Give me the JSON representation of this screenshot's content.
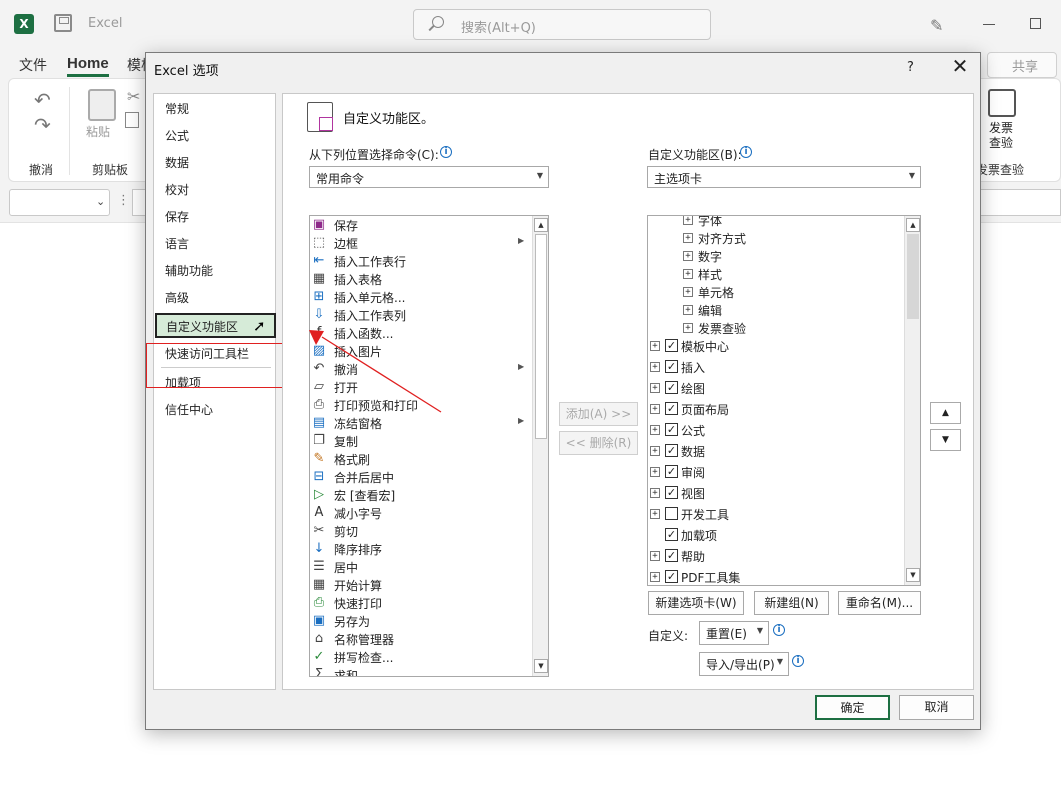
{
  "app": {
    "name": "Excel",
    "search_placeholder": "搜索(Alt+Q)",
    "app_icon_letter": "X"
  },
  "ribbon_tabs": {
    "file": "文件",
    "home": "Home",
    "template": "模板",
    "share": "共享"
  },
  "ribbon": {
    "undo_group": "撤消",
    "paste": "粘贴",
    "clipboard_group": "剪贴板",
    "invoice_label": "发票查验",
    "invoice_group": "发票查验"
  },
  "dialog": {
    "title": "Excel 选项",
    "help": "?",
    "close": "✕",
    "categories": [
      "常规",
      "公式",
      "数据",
      "校对",
      "保存",
      "语言",
      "辅助功能",
      "高级",
      "自定义功能区",
      "快速访问工具栏",
      "加载项",
      "信任中心"
    ],
    "selected_category": "自定义功能区",
    "section_title": "自定义功能区。",
    "left_label": "从下列位置选择命令(C):",
    "right_label": "自定义功能区(B):",
    "command_source": "常用命令",
    "tab_source": "主选项卡",
    "commands": [
      {
        "icon": "save-icon",
        "label": "保存",
        "glyph": "▣",
        "color": "#8e2a8a"
      },
      {
        "icon": "border-icon",
        "label": "边框",
        "glyph": "⬚",
        "color": "#555",
        "submenu": true
      },
      {
        "icon": "insert-row-icon",
        "label": "插入工作表行",
        "glyph": "⇤",
        "color": "#1a6ec0"
      },
      {
        "icon": "insert-table-icon",
        "label": "插入表格",
        "glyph": "▦",
        "color": "#444"
      },
      {
        "icon": "insert-cell-icon",
        "label": "插入单元格...",
        "glyph": "⊞",
        "color": "#1a6ec0"
      },
      {
        "icon": "insert-column-icon",
        "label": "插入工作表列",
        "glyph": "⇩",
        "color": "#1a6ec0"
      },
      {
        "icon": "function-icon",
        "label": "插入函数...",
        "glyph": "ƒ",
        "color": "#333"
      },
      {
        "icon": "picture-icon",
        "label": "插入图片",
        "glyph": "▨",
        "color": "#1a6ec0"
      },
      {
        "icon": "undo-icon",
        "label": "撤消",
        "glyph": "↶",
        "color": "#444",
        "submenu": true
      },
      {
        "icon": "open-icon",
        "label": "打开",
        "glyph": "▱",
        "color": "#444"
      },
      {
        "icon": "print-preview-icon",
        "label": "打印预览和打印",
        "glyph": "⎙",
        "color": "#444"
      },
      {
        "icon": "freeze-panes-icon",
        "label": "冻结窗格",
        "glyph": "▤",
        "color": "#1a6ec0",
        "submenu": true
      },
      {
        "icon": "copy-icon",
        "label": "复制",
        "glyph": "❐",
        "color": "#444"
      },
      {
        "icon": "format-painter-icon",
        "label": "格式刷",
        "glyph": "✎",
        "color": "#c0701a"
      },
      {
        "icon": "merge-center-icon",
        "label": "合并后居中",
        "glyph": "⊟",
        "color": "#1a6ec0"
      },
      {
        "icon": "macro-icon",
        "label": "宏 [查看宏]",
        "glyph": "▷",
        "color": "#2a8a3a"
      },
      {
        "icon": "decrease-font-icon",
        "label": "减小字号",
        "glyph": "A",
        "color": "#333"
      },
      {
        "icon": "cut-icon",
        "label": "剪切",
        "glyph": "✂",
        "color": "#444"
      },
      {
        "icon": "sort-desc-icon",
        "label": "降序排序",
        "glyph": "↓",
        "color": "#1a6ec0"
      },
      {
        "icon": "center-icon",
        "label": "居中",
        "glyph": "☰",
        "color": "#444"
      },
      {
        "icon": "calculate-icon",
        "label": "开始计算",
        "glyph": "▦",
        "color": "#444"
      },
      {
        "icon": "quick-print-icon",
        "label": "快速打印",
        "glyph": "⎙",
        "color": "#2a8a3a"
      },
      {
        "icon": "save-as-icon",
        "label": "另存为",
        "glyph": "▣",
        "color": "#1a6ec0"
      },
      {
        "icon": "name-manager-icon",
        "label": "名称管理器",
        "glyph": "⌂",
        "color": "#444"
      },
      {
        "icon": "spell-check-icon",
        "label": "拼写检查...",
        "glyph": "✓",
        "color": "#2a8a3a"
      },
      {
        "icon": "sum-icon",
        "label": "求和",
        "glyph": "Σ",
        "color": "#444"
      }
    ],
    "add_button": "添加(A) >>",
    "remove_button": "<< 删除(R)",
    "tree_items": [
      {
        "level": 1,
        "label": "字体",
        "checkbox": false,
        "expander": true
      },
      {
        "level": 1,
        "label": "对齐方式",
        "checkbox": false,
        "expander": true
      },
      {
        "level": 1,
        "label": "数字",
        "checkbox": false,
        "expander": true
      },
      {
        "level": 1,
        "label": "样式",
        "checkbox": false,
        "expander": true
      },
      {
        "level": 1,
        "label": "单元格",
        "checkbox": false,
        "expander": true
      },
      {
        "level": 1,
        "label": "编辑",
        "checkbox": false,
        "expander": true
      },
      {
        "level": 1,
        "label": "发票查验",
        "checkbox": false,
        "expander": true
      },
      {
        "level": 0,
        "label": "模板中心",
        "checkbox": true,
        "checked": true,
        "expander": true
      },
      {
        "level": 0,
        "label": "插入",
        "checkbox": true,
        "checked": true,
        "expander": true
      },
      {
        "level": 0,
        "label": "绘图",
        "checkbox": true,
        "checked": true,
        "expander": true
      },
      {
        "level": 0,
        "label": "页面布局",
        "checkbox": true,
        "checked": true,
        "expander": true
      },
      {
        "level": 0,
        "label": "公式",
        "checkbox": true,
        "checked": true,
        "expander": true
      },
      {
        "level": 0,
        "label": "数据",
        "checkbox": true,
        "checked": true,
        "expander": true
      },
      {
        "level": 0,
        "label": "审阅",
        "checkbox": true,
        "checked": true,
        "expander": true
      },
      {
        "level": 0,
        "label": "视图",
        "checkbox": true,
        "checked": true,
        "expander": true
      },
      {
        "level": 0,
        "label": "开发工具",
        "checkbox": true,
        "checked": false,
        "expander": true
      },
      {
        "level": 0,
        "label": "加载项",
        "checkbox": true,
        "checked": true,
        "expander": false
      },
      {
        "level": 0,
        "label": "帮助",
        "checkbox": true,
        "checked": true,
        "expander": true
      },
      {
        "level": 0,
        "label": "PDF工具集",
        "checkbox": true,
        "checked": true,
        "expander": true
      }
    ],
    "new_tab_button": "新建选项卡(W)",
    "new_group_button": "新建组(N)",
    "rename_button": "重命名(M)...",
    "customize_label": "自定义:",
    "reset_button": "重置(E)",
    "import_export_button": "导入/导出(P)",
    "ok_button": "确定",
    "cancel_button": "取消"
  },
  "colors": {
    "accent": "#1d6f42",
    "selection": "#d6ebd8",
    "annotation": "#e02020"
  }
}
